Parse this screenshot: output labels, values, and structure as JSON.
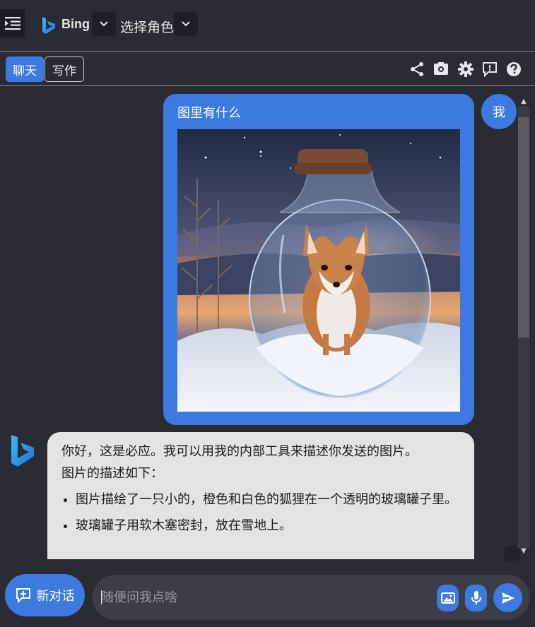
{
  "header": {
    "app_name": "Bing",
    "role_label": "选择角色"
  },
  "tabs": [
    {
      "label": "聊天",
      "active": true
    },
    {
      "label": "写作",
      "active": false
    }
  ],
  "toolbar_icons": [
    "share-icon",
    "screenshot-icon",
    "settings-icon",
    "feedback-icon",
    "help-icon"
  ],
  "messages": {
    "user": {
      "avatar_label": "我",
      "text": "图里有什么",
      "image_alt": "fox in a glass jar on snow at sunset"
    },
    "bot": {
      "intro": "你好，这是必应。我可以用我的内部工具来描述你发送的图片。",
      "intro2": "图片的描述如下：",
      "bullets": [
        "图片描绘了一只小的，橙色和白色的狐狸在一个透明的玻璃罐子里。",
        "玻璃罐子用软木塞密封，放在雪地上。"
      ]
    }
  },
  "composer": {
    "new_chat_label": "新对话",
    "placeholder": "随便问我点啥"
  },
  "colors": {
    "accent": "#3c7adf",
    "background": "#2b2b33",
    "bot_bubble": "#e3e3e3"
  }
}
